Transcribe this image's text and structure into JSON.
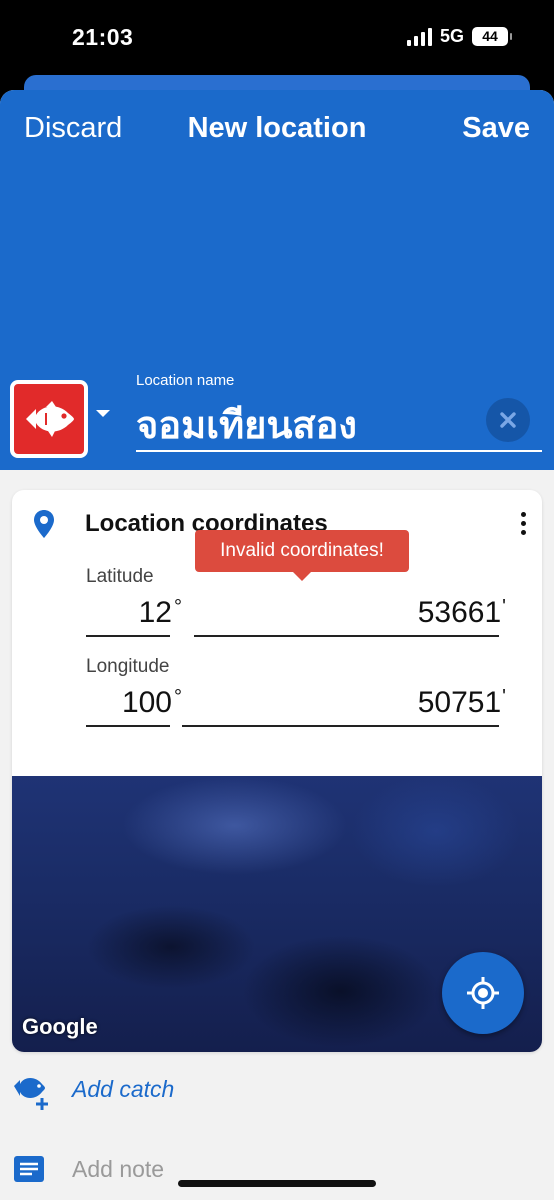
{
  "status_bar": {
    "time": "21:03",
    "network": "5G",
    "battery": "44"
  },
  "header": {
    "discard_label": "Discard",
    "title": "New location",
    "save_label": "Save"
  },
  "location_name": {
    "label": "Location name",
    "value": "จอมเทียนสอง"
  },
  "coordinates": {
    "title": "Location coordinates",
    "error_tooltip": "Invalid coordinates!",
    "latitude": {
      "label": "Latitude",
      "degrees": "12",
      "degree_symbol": "°",
      "minutes": "53661",
      "minute_symbol": "'"
    },
    "longitude": {
      "label": "Longitude",
      "degrees": "100",
      "degree_symbol": "°",
      "minutes": "50751",
      "minute_symbol": "'"
    }
  },
  "map": {
    "attribution": "Google"
  },
  "actions": {
    "add_catch": "Add catch",
    "add_note": "Add note"
  },
  "colors": {
    "primary": "#1b6acb",
    "error": "#dc4b3e",
    "fish_tile": "#e12a2a"
  }
}
